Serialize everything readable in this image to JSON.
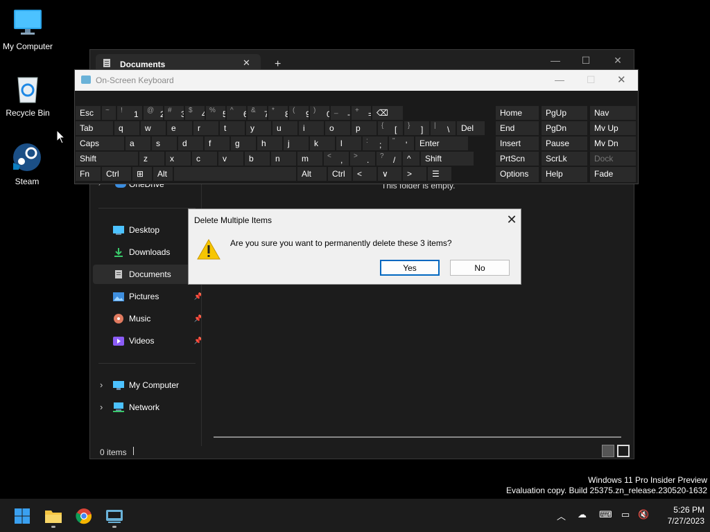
{
  "desktop": {
    "icons": [
      {
        "label": "My Computer"
      },
      {
        "label": "Recycle Bin"
      },
      {
        "label": "Steam"
      }
    ]
  },
  "explorer": {
    "tab_title": "Documents",
    "new_tab": "+",
    "nav": {
      "onedrive": "OneDrive",
      "desktop": "Desktop",
      "downloads": "Downloads",
      "documents": "Documents",
      "pictures": "Pictures",
      "music": "Music",
      "videos": "Videos",
      "my_computer": "My Computer",
      "network": "Network"
    },
    "empty_message": "This folder is empty.",
    "status": "0 items"
  },
  "osk": {
    "title": "On-Screen Keyboard",
    "rows": [
      [
        {
          "label": "Esc"
        },
        {
          "sub": "~",
          "label": "`"
        },
        {
          "sub": "!",
          "label": "1"
        },
        {
          "sub": "@",
          "label": "2"
        },
        {
          "sub": "#",
          "label": "3"
        },
        {
          "sub": "$",
          "label": "4"
        },
        {
          "sub": "%",
          "label": "5"
        },
        {
          "sub": "^",
          "label": "6"
        },
        {
          "sub": "&",
          "label": "7"
        },
        {
          "sub": "*",
          "label": "8"
        },
        {
          "sub": "(",
          "label": "9"
        },
        {
          "sub": ")",
          "label": "0"
        },
        {
          "sub": "_",
          "label": "-"
        },
        {
          "sub": "+",
          "label": "="
        },
        {
          "label": "⌫"
        }
      ],
      [
        {
          "label": "Tab"
        },
        {
          "label": "q"
        },
        {
          "label": "w"
        },
        {
          "label": "e"
        },
        {
          "label": "r"
        },
        {
          "label": "t"
        },
        {
          "label": "y"
        },
        {
          "label": "u"
        },
        {
          "label": "i"
        },
        {
          "label": "o"
        },
        {
          "label": "p"
        },
        {
          "sub": "{",
          "label": "["
        },
        {
          "sub": "}",
          "label": "]"
        },
        {
          "sub": "|",
          "label": "\\"
        },
        {
          "label": "Del"
        }
      ],
      [
        {
          "label": "Caps"
        },
        {
          "label": "a"
        },
        {
          "label": "s"
        },
        {
          "label": "d"
        },
        {
          "label": "f"
        },
        {
          "label": "g"
        },
        {
          "label": "h"
        },
        {
          "label": "j"
        },
        {
          "label": "k"
        },
        {
          "label": "l"
        },
        {
          "sub": ":",
          "label": ";"
        },
        {
          "sub": "\"",
          "label": "'"
        },
        {
          "label": "Enter"
        }
      ],
      [
        {
          "label": "Shift"
        },
        {
          "label": "z"
        },
        {
          "label": "x"
        },
        {
          "label": "c"
        },
        {
          "label": "v"
        },
        {
          "label": "b"
        },
        {
          "label": "n"
        },
        {
          "label": "m"
        },
        {
          "sub": "<",
          "label": ","
        },
        {
          "sub": ">",
          "label": "."
        },
        {
          "sub": "?",
          "label": "/"
        },
        {
          "label": "^"
        },
        {
          "label": "Shift"
        }
      ],
      [
        {
          "label": "Fn"
        },
        {
          "label": "Ctrl"
        },
        {
          "label": "⊞"
        },
        {
          "label": "Alt"
        },
        {
          "label": ""
        },
        {
          "label": "Alt"
        },
        {
          "label": "Ctrl"
        },
        {
          "label": "<"
        },
        {
          "label": "∨"
        },
        {
          "label": ">"
        },
        {
          "label": "☰"
        }
      ]
    ],
    "side": [
      [
        "Home",
        "PgUp",
        "Nav"
      ],
      [
        "End",
        "PgDn",
        "Mv Up"
      ],
      [
        "Insert",
        "Pause",
        "Mv Dn"
      ],
      [
        "PrtScn",
        "ScrLk",
        "Dock"
      ],
      [
        "Options",
        "Help",
        "Fade"
      ]
    ]
  },
  "dialog": {
    "title": "Delete Multiple Items",
    "message": "Are you sure you want to permanently delete these 3 items?",
    "yes": "Yes",
    "no": "No",
    "close": "✕"
  },
  "taskbar": {
    "time": "5:26 PM",
    "date": "7/27/2023"
  },
  "watermark": {
    "line1": "Windows 11 Pro Insider Preview",
    "line2": "Evaluation copy. Build 25375.zn_release.230520-1632"
  },
  "colors": {
    "accent": "#0067c0",
    "warning": "#f7c600"
  }
}
